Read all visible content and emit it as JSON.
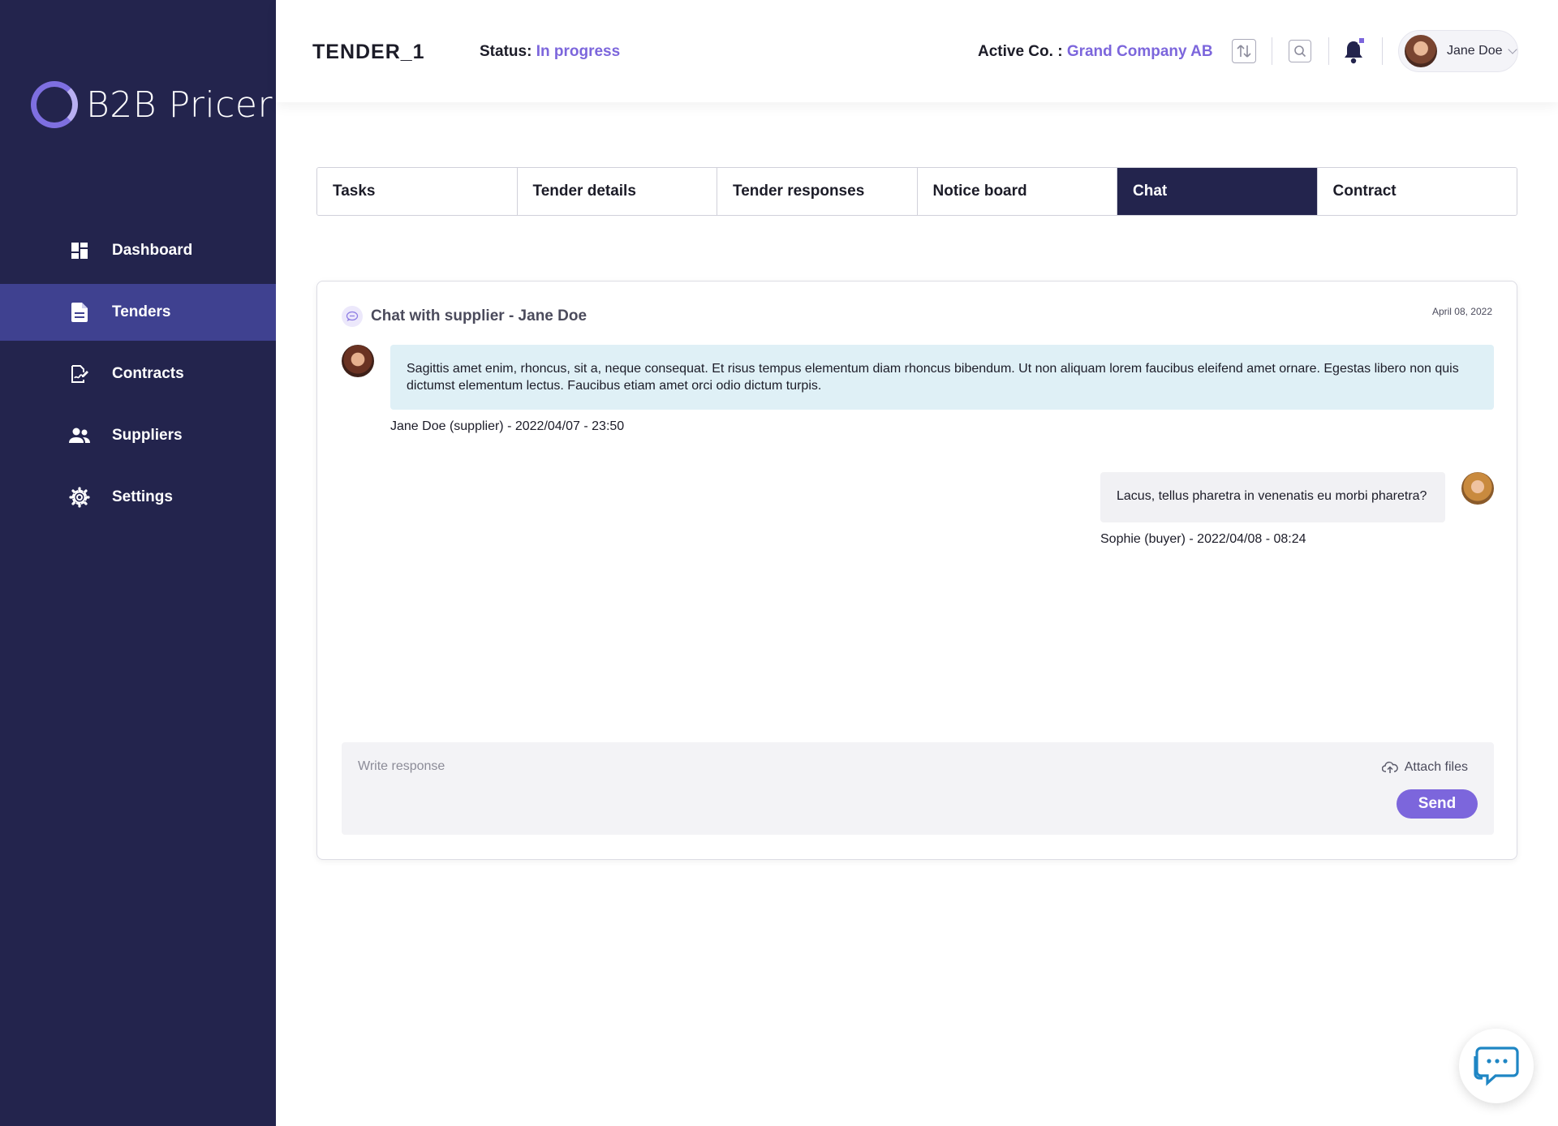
{
  "sidebar": {
    "logo_text": "B2B Pricer",
    "items": [
      {
        "label": "Dashboard",
        "icon": "dashboard-icon"
      },
      {
        "label": "Tenders",
        "icon": "document-icon",
        "active": true
      },
      {
        "label": "Contracts",
        "icon": "contract-icon"
      },
      {
        "label": "Suppliers",
        "icon": "people-icon"
      },
      {
        "label": "Settings",
        "icon": "gear-icon"
      }
    ]
  },
  "header": {
    "tender_title": "TENDER_1",
    "status_label": "Status:",
    "status_value": "In progress",
    "active_co_label": "Active Co. :",
    "active_co_value": "Grand Company AB",
    "user_name": "Jane Doe",
    "accent_color": "#7c66dc"
  },
  "tabs": [
    {
      "label": "Tasks"
    },
    {
      "label": "Tender details"
    },
    {
      "label": "Tender responses"
    },
    {
      "label": "Notice board"
    },
    {
      "label": "Chat",
      "active": true
    },
    {
      "label": "Contract"
    }
  ],
  "chat": {
    "title": "Chat with supplier - Jane Doe",
    "date": "April 08, 2022",
    "messages": [
      {
        "text": "Sagittis amet enim, rhoncus, sit a, neque consequat. Et risus tempus elementum diam rhoncus bibendum. Ut non aliquam lorem faucibus eleifend amet ornare. Egestas libero non quis dictumst elementum lectus. Faucibus etiam amet orci odio dictum turpis.",
        "meta": "Jane Doe (supplier) - 2022/04/07 - 23:50",
        "direction": "incoming"
      },
      {
        "text": "Lacus, tellus pharetra in venenatis eu morbi pharetra?",
        "meta": "Sophie (buyer) - 2022/04/08 - 08:24",
        "direction": "outgoing"
      }
    ],
    "composer": {
      "placeholder": "Write response",
      "attach_label": "Attach files",
      "send_label": "Send"
    }
  }
}
